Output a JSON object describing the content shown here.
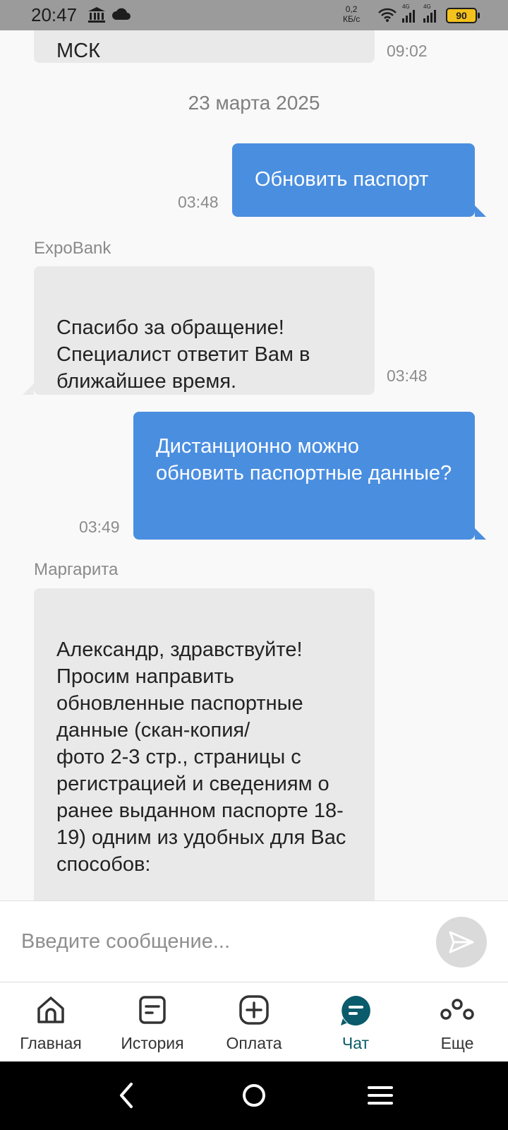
{
  "status_bar": {
    "time": "20:47",
    "net_speed_value": "0,2",
    "net_speed_unit": "КБ/с",
    "battery": "90",
    "icons": [
      "bank-icon",
      "cloud-icon",
      "wifi-icon",
      "signal-4g-icon",
      "signal-4g-icon",
      "battery-icon"
    ]
  },
  "chat": {
    "partial_message": {
      "text": "МСК",
      "time": "09:02"
    },
    "date_separator": "23 марта 2025",
    "messages": [
      {
        "direction": "out",
        "text": "Обновить паспорт",
        "time": "03:48"
      },
      {
        "direction": "in",
        "sender": "ExpoBank",
        "text": "Спасибо за обращение!\nСпециалист ответит Вам в ближайшее время.",
        "time": "03:48"
      },
      {
        "direction": "out",
        "text": "Дистанционно можно обновить паспортные данные?",
        "time": "03:49"
      },
      {
        "direction": "in",
        "sender": "Маргарита",
        "text": "Александр, здравствуйте! Просим направить обновленные паспортные данные (скан-копия/\nфото 2-3 стр., страницы с регистрацией и сведениям о ранее выданном паспорте 18-19) одним из удобных для Вас способов:\n\nраздел «Заявление"
      }
    ]
  },
  "input": {
    "placeholder": "Введите сообщение..."
  },
  "nav": {
    "items": [
      {
        "label": "Главная",
        "icon": "home-icon"
      },
      {
        "label": "История",
        "icon": "history-icon"
      },
      {
        "label": "Оплата",
        "icon": "payment-plus-icon"
      },
      {
        "label": "Чат",
        "icon": "chat-icon",
        "active": true
      },
      {
        "label": "Еще",
        "icon": "more-icon"
      }
    ]
  },
  "colors": {
    "outgoing_bubble": "#4a8ee0",
    "incoming_bubble": "#e9e9e9",
    "active_nav": "#0a5b6b",
    "status_bar": "#9b9b9b"
  }
}
